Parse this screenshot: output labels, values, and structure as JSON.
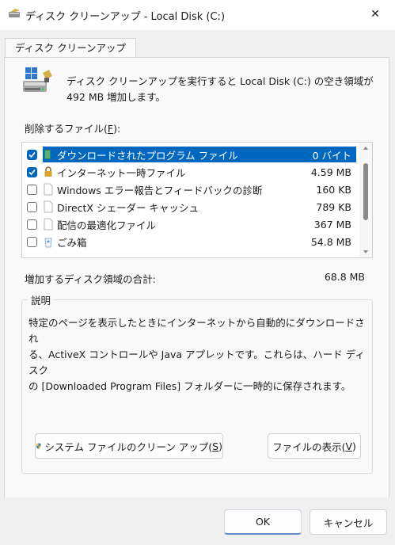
{
  "window": {
    "title": "ディスク クリーンアップ - Local Disk  (C:)",
    "close_symbol": "✕"
  },
  "tab": {
    "label": "ディスク クリーンアップ"
  },
  "intro": {
    "line1": "ディスク クリーンアップを実行すると Local Disk (C:) の空き領域が",
    "line2": "492 MB 増加します。"
  },
  "files_label": {
    "before": "削除するファイル(",
    "mnemonic": "F",
    "after": "):"
  },
  "files": [
    {
      "name": "ダウンロードされたプログラム ファイル",
      "size": "0 バイト",
      "checked": true,
      "selected": true,
      "icon": "folder-icon"
    },
    {
      "name": "インターネット一時ファイル",
      "size": "4.59 MB",
      "checked": true,
      "selected": false,
      "icon": "lock-icon"
    },
    {
      "name": "Windows エラー報告とフィードバックの診断",
      "size": "160 KB",
      "checked": false,
      "selected": false,
      "icon": "file-icon"
    },
    {
      "name": "DirectX シェーダー キャッシュ",
      "size": "789 KB",
      "checked": false,
      "selected": false,
      "icon": "file-icon"
    },
    {
      "name": "配信の最適化ファイル",
      "size": "367 MB",
      "checked": false,
      "selected": false,
      "icon": "file-icon"
    },
    {
      "name": "ごみ箱",
      "size": "54.8 MB",
      "checked": false,
      "selected": false,
      "icon": "recycle-bin-icon"
    }
  ],
  "total": {
    "label": "増加するディスク領域の合計:",
    "value": "68.8 MB"
  },
  "description": {
    "legend": "説明",
    "line1": "特定のページを表示したときにインターネットから自動的にダウンロードされ",
    "line2": "る、ActiveX コントロールや Java アプレットです。これらは、ハード ディスク",
    "line3": "の [Downloaded Program Files] フォルダーに一時的に保存されます。"
  },
  "buttons": {
    "cleanup_system": {
      "before": "システム ファイルのクリーン アップ(",
      "mnemonic": "S",
      "after": ")"
    },
    "view_files": {
      "before": "ファイルの表示(",
      "mnemonic": "V",
      "after": ")"
    },
    "ok": "OK",
    "cancel": "キャンセル"
  },
  "colors": {
    "accent": "#0067c0",
    "selection": "#0067c0"
  }
}
